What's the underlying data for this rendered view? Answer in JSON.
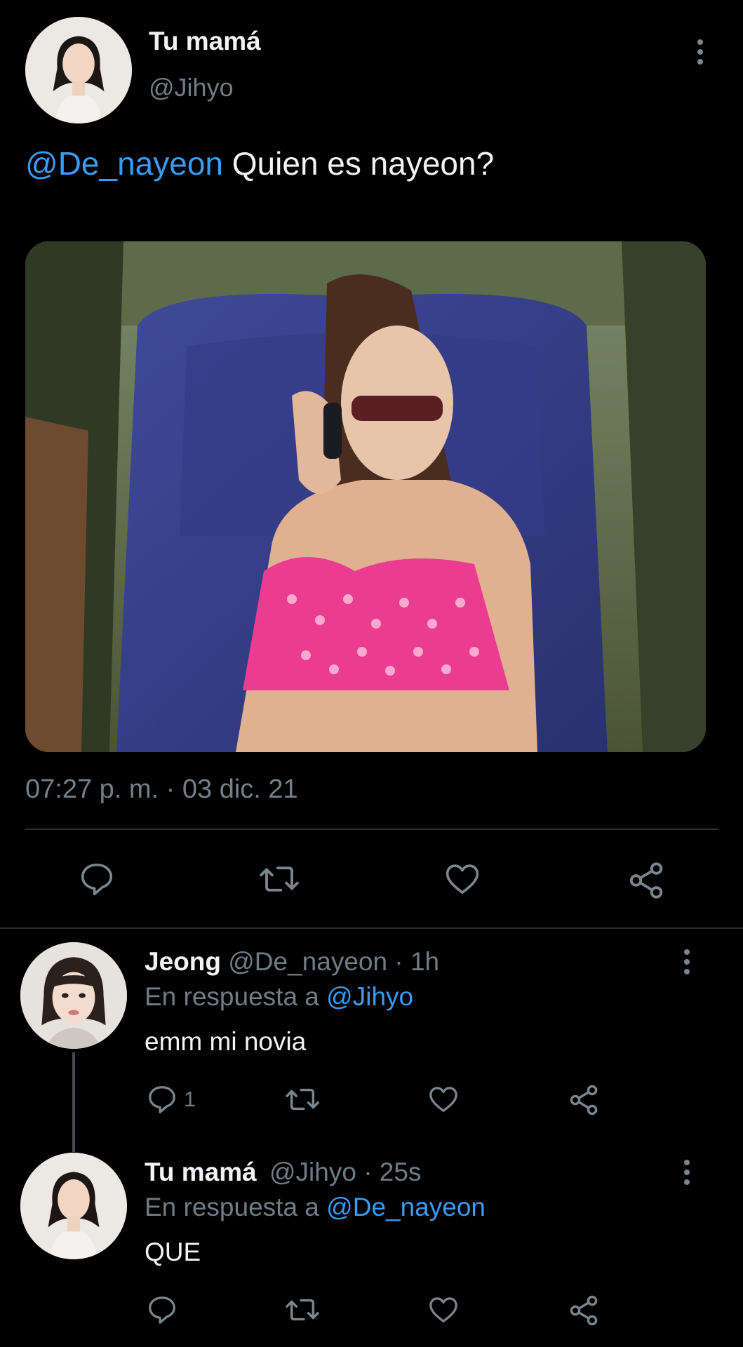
{
  "main_tweet": {
    "display_name": "Tu mamá",
    "handle": "@Jihyo",
    "mention": "@De_nayeon",
    "text": " Quien es nayeon?",
    "timestamp": "07:27 p. m. · 03 dic. 21",
    "media_alt": "photo",
    "actions": [
      "reply-icon",
      "retweet-icon",
      "like-icon",
      "share-icon"
    ]
  },
  "replies": [
    {
      "display_name": "Jeong",
      "handle": "@De_nayeon",
      "time": "· 1h",
      "reply_prefix": "En respuesta a",
      "reply_to": "@Jihyo",
      "text": "emm mi novia",
      "reply_count": "1"
    },
    {
      "display_name": "Tu mamá",
      "handle": "@Jihyo",
      "time": "· 25s",
      "reply_prefix": "En respuesta a",
      "reply_to": "@De_nayeon",
      "text": "QUE",
      "reply_count": ""
    }
  ],
  "colors": {
    "background": "#000000",
    "link": "#3a9bf0",
    "muted": "#717b84",
    "text": "#e7e9ea"
  }
}
